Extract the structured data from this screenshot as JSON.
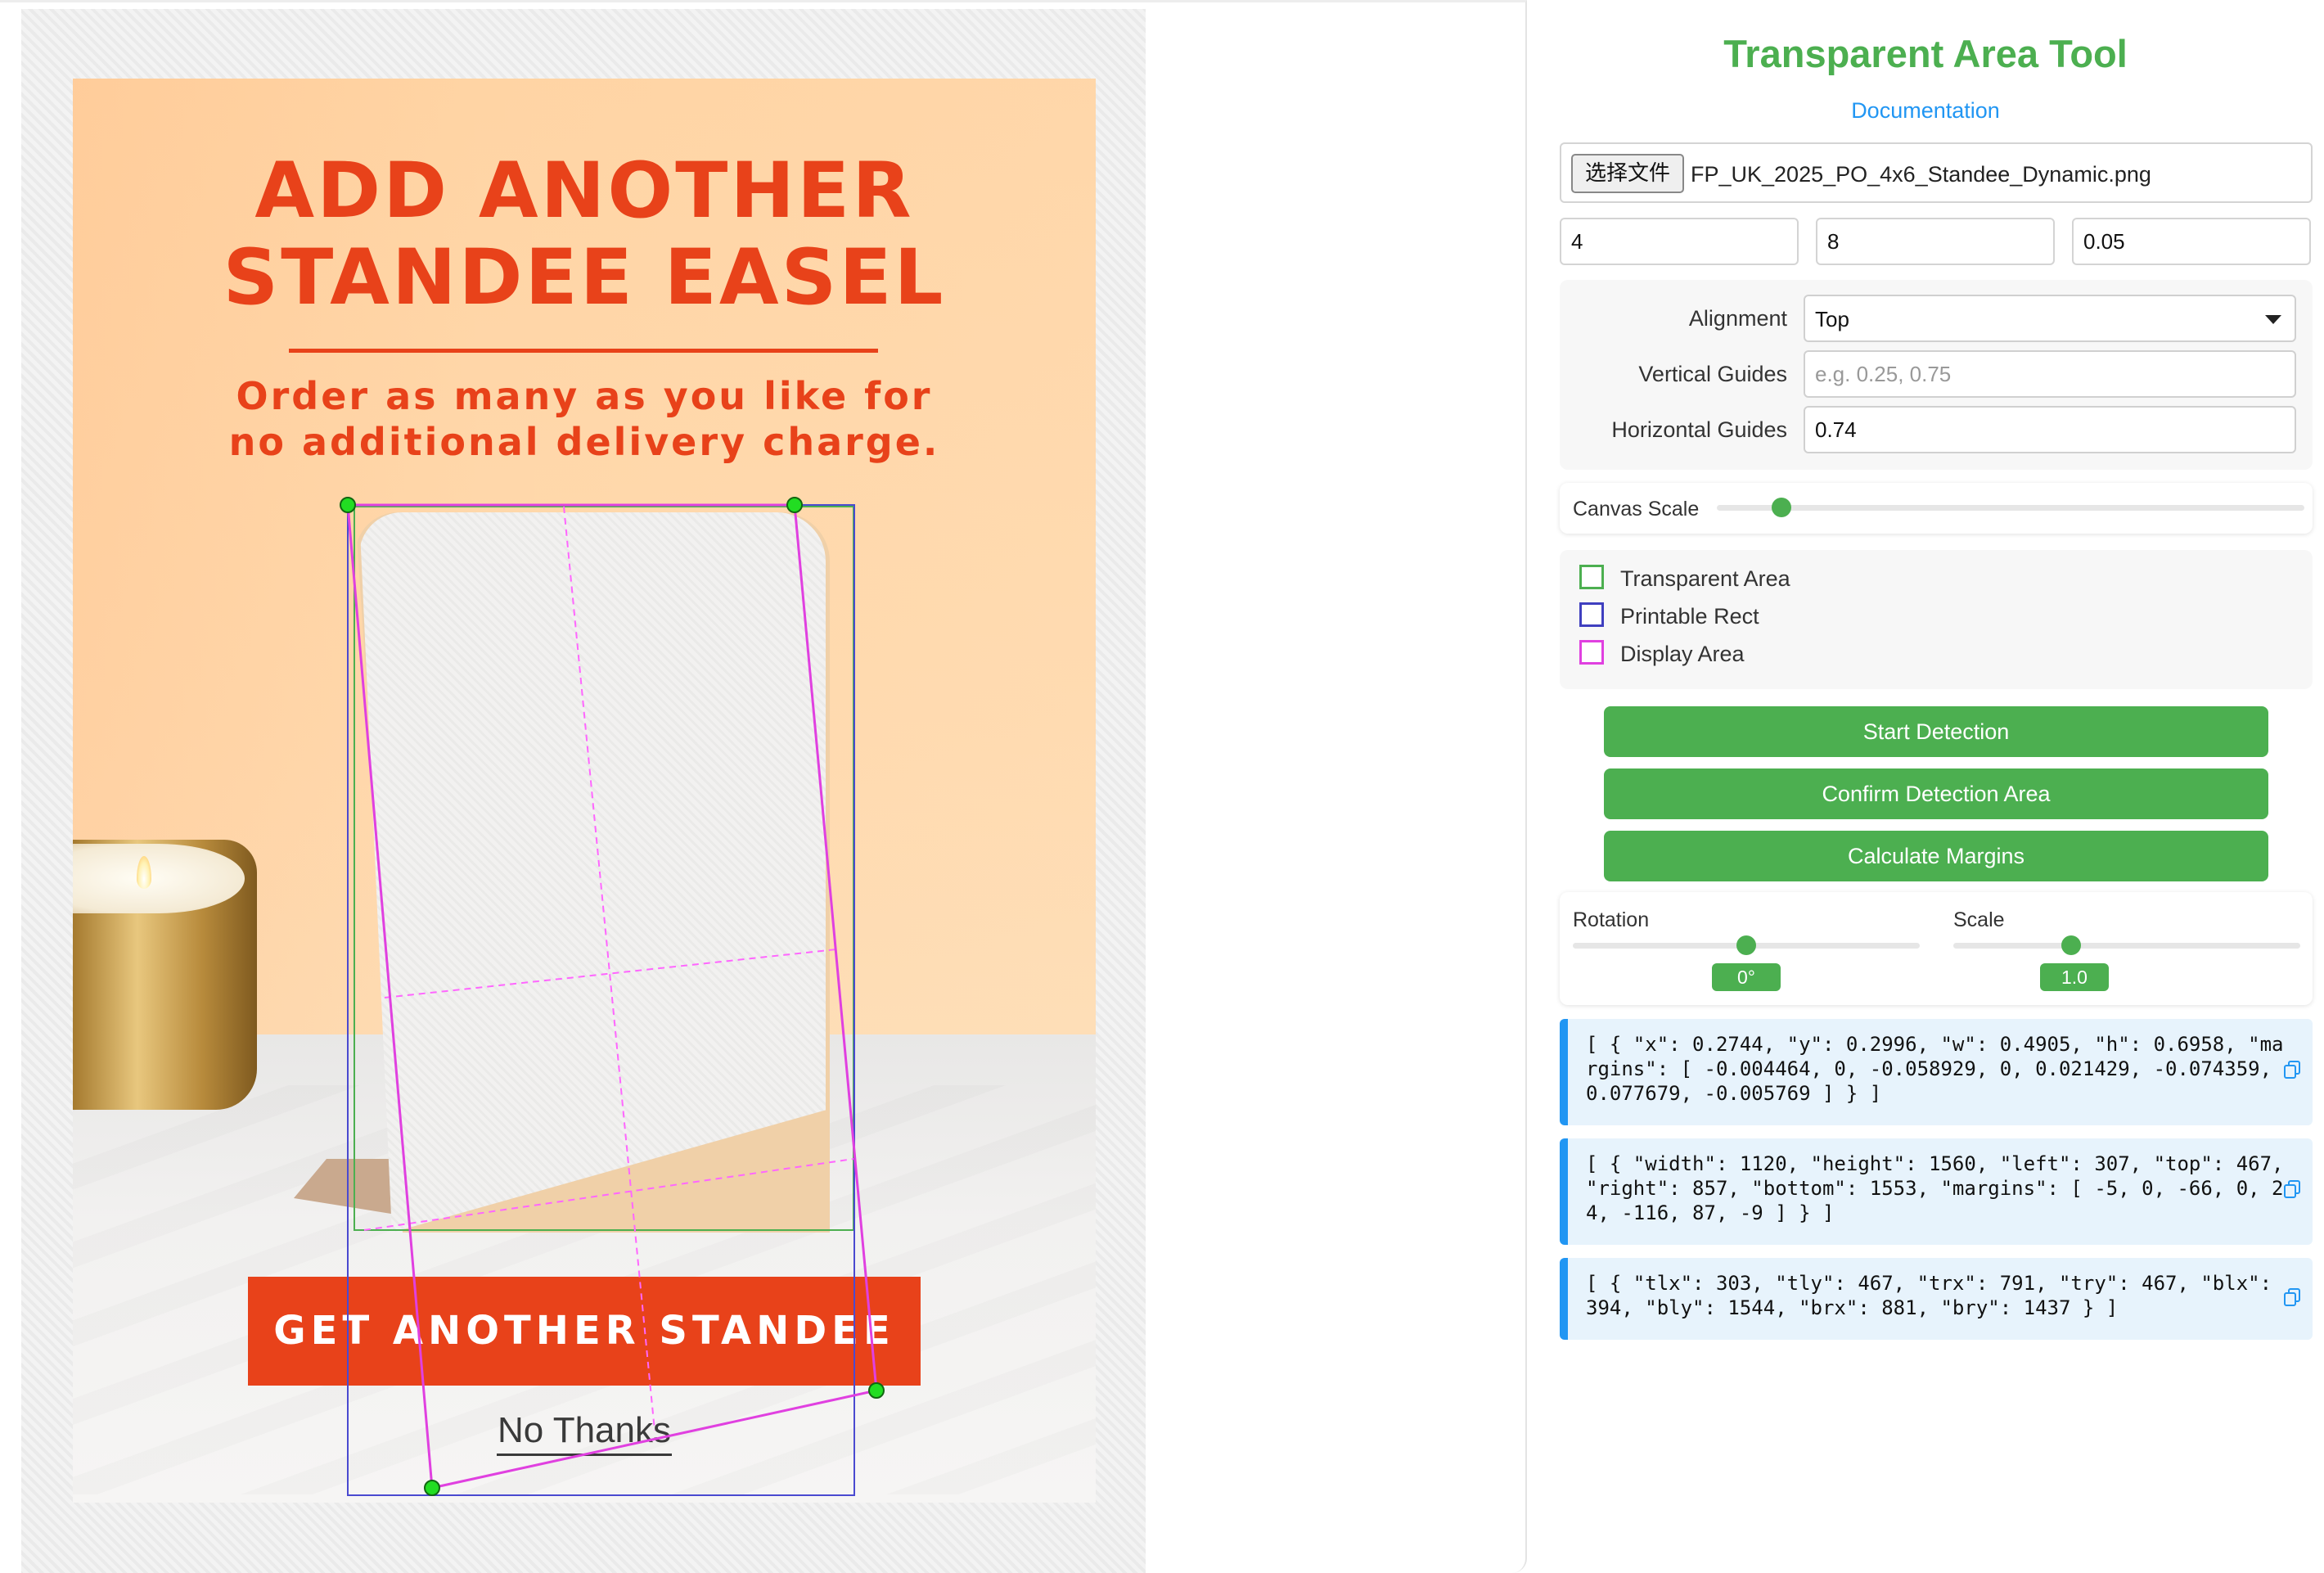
{
  "poster": {
    "headline_line1": "ADD ANOTHER",
    "headline_line2": "STANDEE EASEL",
    "subline_line1": "Order as many as you like for",
    "subline_line2": "no additional delivery charge.",
    "cta_label": "GET ANOTHER STANDEE",
    "no_thanks_label": "No Thanks"
  },
  "panel": {
    "title": "Transparent Area Tool",
    "doc_link": "Documentation",
    "file_button": "选择文件",
    "file_name": "FP_UK_2025_PO_4x6_Standee_Dynamic.png",
    "inputs": [
      "4",
      "8",
      "0.05"
    ],
    "alignment_label": "Alignment",
    "alignment_value": "Top",
    "vertical_guides_label": "Vertical Guides",
    "vertical_guides_placeholder": "e.g. 0.25, 0.75",
    "vertical_guides_value": "",
    "horizontal_guides_label": "Horizontal Guides",
    "horizontal_guides_value": "0.74",
    "canvas_scale_label": "Canvas Scale",
    "canvas_scale_level": 0.11,
    "legend": [
      {
        "label": "Transparent Area",
        "color": "#4caf50"
      },
      {
        "label": "Printable Rect",
        "color": "#3f3fbf"
      },
      {
        "label": "Display Area",
        "color": "#e040e0"
      }
    ],
    "buttons": {
      "start": "Start Detection",
      "confirm": "Confirm Detection Area",
      "calculate": "Calculate Margins"
    },
    "rotation_label": "Rotation",
    "rotation_value": "0°",
    "rotation_level": 0.5,
    "scale_label": "Scale",
    "scale_value": "1.0",
    "scale_level": 0.34,
    "json_outputs": [
      "[ { \"x\": 0.2744, \"y\": 0.2996, \"w\": 0.4905, \"h\": 0.6958, \"margins\": [ -0.004464, 0, -0.058929, 0, 0.021429, -0.074359, 0.077679, -0.005769 ] } ]",
      "[ { \"width\": 1120, \"height\": 1560, \"left\": 307, \"top\": 467, \"right\": 857, \"bottom\": 1553, \"margins\": [ -5, 0, -66, 0, 24, -116, 87, -9 ] } ]",
      "[ { \"tlx\": 303, \"tly\": 467, \"trx\": 791, \"try\": 467, \"blx\": 394, \"bly\": 1544, \"brx\": 881, \"bry\": 1437 } ]"
    ]
  }
}
